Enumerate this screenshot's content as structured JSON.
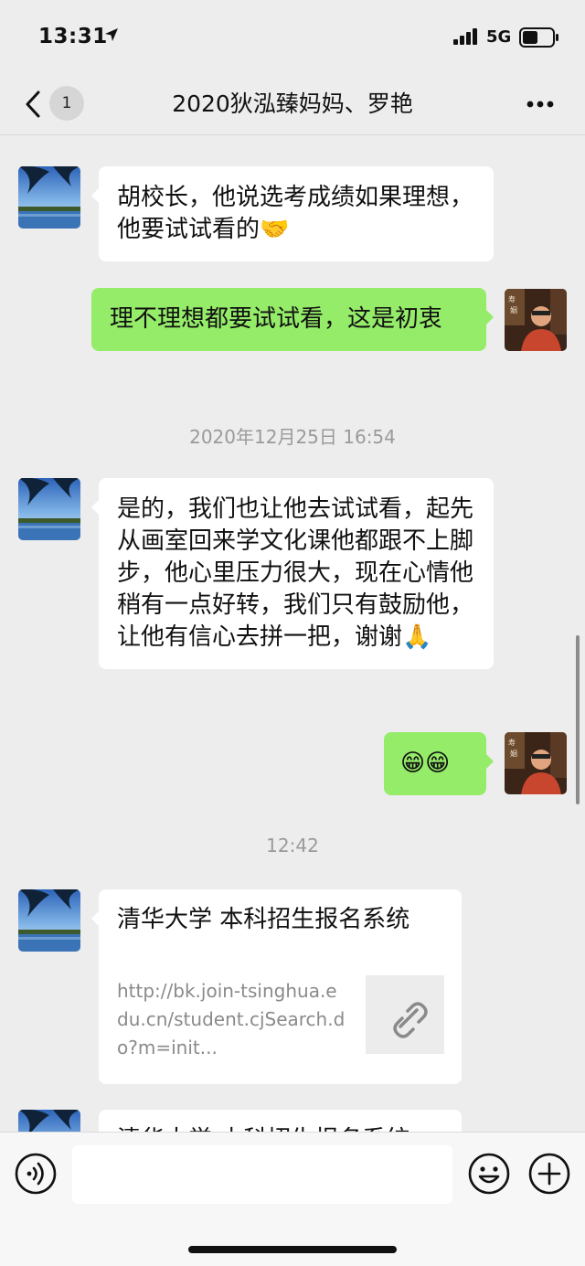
{
  "status_bar": {
    "time": "13:31",
    "network": "5G",
    "icons": [
      "location-arrow-icon",
      "cellular-signal-icon",
      "battery-icon"
    ]
  },
  "nav": {
    "title": "2020狄泓臻妈妈、罗艳",
    "unread_count": "1",
    "icons": [
      "chevron-left-icon",
      "more-dots-icon"
    ]
  },
  "messages": [
    {
      "side": "in",
      "text": "胡校长，他说选考成绩如果理想，他要试试看的🤝"
    },
    {
      "side": "out",
      "text": "理不理想都要试试看，这是初衷"
    },
    {
      "type": "time",
      "text": "2020年12月25日 16:54"
    },
    {
      "side": "in",
      "text": "是的，我们也让他去试试看，起先从画室回来学文化课他都跟不上脚步，他心里压力很大，现在心情他稍有一点好转，我们只有鼓励他，让他有信心去拼一把，谢谢🙏"
    },
    {
      "side": "out",
      "text": "😁😁"
    },
    {
      "type": "time",
      "text": "12:42"
    },
    {
      "side": "in",
      "type": "link",
      "title": "清华大学 本科招生报名系统",
      "url": "http://bk.join-tsinghua.edu.cn/student.cjSearch.do?m=init...",
      "icon": "link-icon"
    },
    {
      "side": "in",
      "type": "link",
      "title": "清华大学 本科招生报名系统"
    }
  ],
  "input_bar": {
    "icons": [
      "voice-icon",
      "emoji-icon",
      "plus-icon"
    ]
  },
  "colors": {
    "background": "#ededed",
    "outgoing_bubble": "#95ec69",
    "incoming_bubble": "#ffffff",
    "timestamp": "#9a9a9a"
  }
}
